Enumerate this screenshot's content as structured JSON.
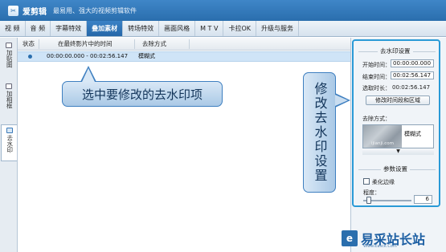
{
  "app": {
    "name": "爱剪辑",
    "slogan": "最易用、强大的视频剪辑软件"
  },
  "tabs": [
    {
      "label": "视 频"
    },
    {
      "label": "音 频"
    },
    {
      "label": "字幕特效"
    },
    {
      "label": "叠加素材",
      "active": true
    },
    {
      "label": "转场特效"
    },
    {
      "label": "画面风格"
    },
    {
      "label": "M T V"
    },
    {
      "label": "卡拉OK"
    },
    {
      "label": "升级与服务"
    }
  ],
  "side_tabs": [
    {
      "label": "加贴图"
    },
    {
      "label": "加相框"
    },
    {
      "label": "去水印",
      "active": true
    }
  ],
  "list": {
    "headers": [
      "状态",
      "在最终影片中的时间",
      "去除方式"
    ],
    "rows": [
      {
        "time": "00:00:00.000 - 00:02:56.147",
        "mode": "模糊式",
        "selected": true
      }
    ]
  },
  "callouts": {
    "select": "选中要修改的去水印项",
    "modify": "修改去水印设置"
  },
  "settings": {
    "group_title": "去水印设置",
    "start_label": "开始时间：",
    "start_value": "00:00:00.000",
    "end_label": "结束时间：",
    "end_value": "00:02:56.147",
    "duration_label": "选取时长：",
    "duration_value": "00:02:56.147",
    "modify_button": "修改时间段和区域",
    "method_label": "去除方式：",
    "method_thumb_text": "ijianji.com",
    "method_value": "模糊式",
    "dropdown_arrow": "▼",
    "params_title": "参数设置",
    "soften_label": "柔化边缘",
    "degree_label": "程度：",
    "degree_value": 6
  },
  "site": {
    "logo": "e",
    "name": "易采站长站",
    "url": "Www.Easck.Com"
  }
}
